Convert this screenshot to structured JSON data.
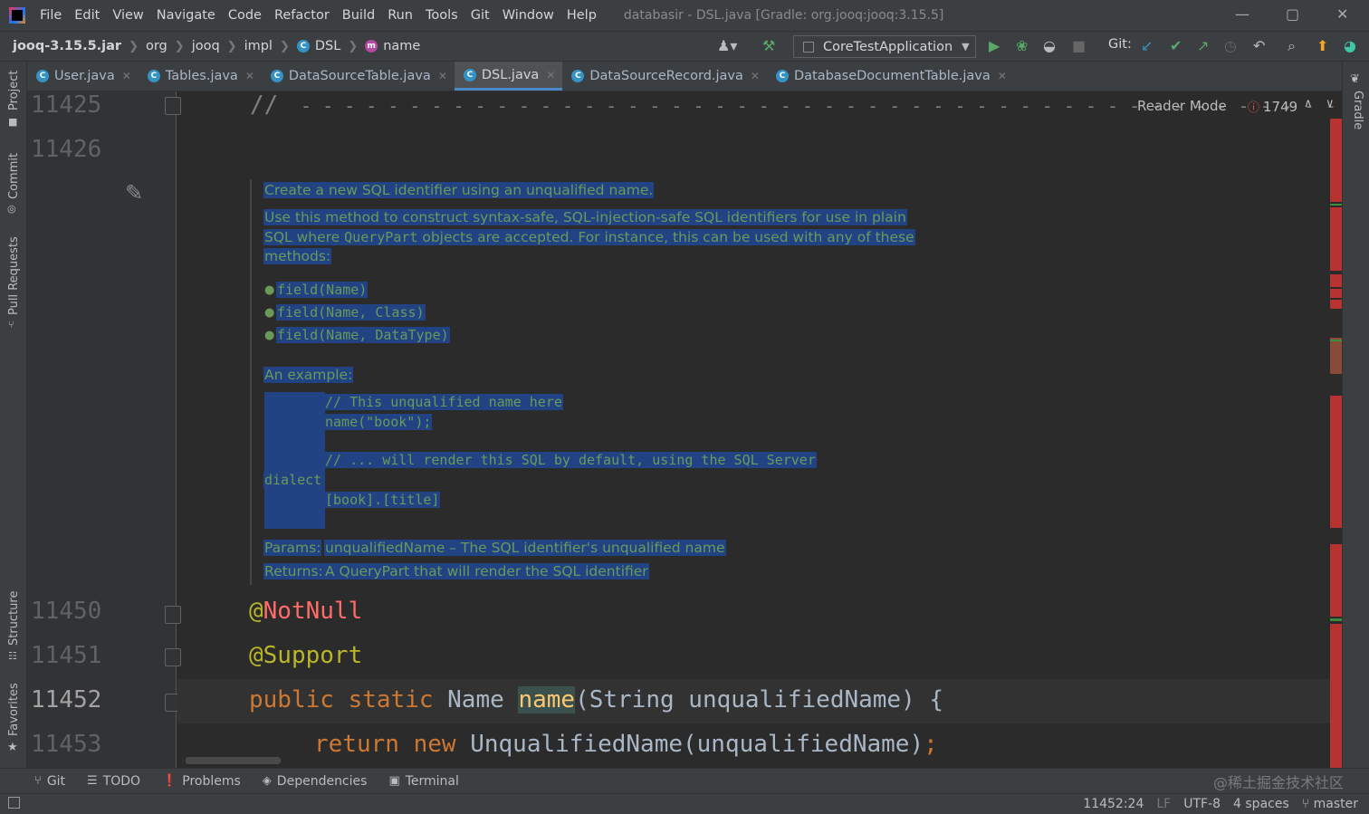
{
  "menu": {
    "items": [
      "File",
      "Edit",
      "View",
      "Navigate",
      "Code",
      "Refactor",
      "Build",
      "Run",
      "Tools",
      "Git",
      "Window",
      "Help"
    ],
    "title": "databasir - DSL.java [Gradle: org.jooq:jooq:3.15.5]"
  },
  "breadcrumb": {
    "jar": "jooq-3.15.5.jar",
    "org": "org",
    "jooq": "jooq",
    "impl": "impl",
    "cls": "DSL",
    "method": "name",
    "class_badge": "C",
    "method_badge": "m"
  },
  "toolbar": {
    "run_config": "CoreTestApplication",
    "git_label": "Git:"
  },
  "tabs": [
    {
      "label": "User.java",
      "badge": "C"
    },
    {
      "label": "Tables.java",
      "badge": "C"
    },
    {
      "label": "DataSourceTable.java",
      "badge": "C"
    },
    {
      "label": "DSL.java",
      "badge": "C"
    },
    {
      "label": "DataSourceRecord.java",
      "badge": "C"
    },
    {
      "label": "DatabaseDocumentTable.java",
      "badge": "C"
    }
  ],
  "left_tools": {
    "project": "Project",
    "commit": "Commit",
    "pull_requests": "Pull Requests",
    "structure": "Structure",
    "favorites": "Favorites"
  },
  "right_tools": {
    "gradle": "Gradle"
  },
  "editor": {
    "reader_mode": "Reader Mode",
    "error_count": "1749",
    "line_numbers": {
      "l1": "11425",
      "l2": "11426",
      "l3": "11450",
      "l4": "11451",
      "l5": "11452",
      "l6": "11453"
    },
    "code": {
      "comment_slash": "//",
      "comment_dashes": "- - - - - - - - - - - - - - - - - - - - - - - - - - - - - - - - - - - - - - - - - - - - - - - - - - -",
      "at1": "@",
      "notnull": "NotNull",
      "support": "@Support",
      "kw_public": "public",
      "kw_static": "static",
      "type_name": "Name",
      "method_name": "name",
      "params": "(String unqualifiedName) {",
      "kw_return": "return",
      "kw_new": "new",
      "ret_expr": "UnqualifiedName(unqualifiedName)",
      "semicolon": ";"
    },
    "doc": {
      "summary": "Create a new SQL identifier using an unqualified name.",
      "para_1": "Use this method to construct syntax-safe, SQL-injection-safe SQL identifiers for use in plain",
      "para_2a": "SQL where ",
      "para_2_code": "QueryPart",
      "para_2b": " objects are accepted. For instance, this can be used with any of these",
      "para_3": "methods:",
      "list": [
        "field(Name)",
        "field(Name, Class)",
        "field(Name, DataType)"
      ],
      "example_label": "An example:",
      "example_lines": {
        "e1": "// This unqualified name here",
        "e2": "name(\"book\");",
        "e3": "// ... will render this SQL by default, using the SQL Server",
        "e4": "dialect",
        "e5": "[book].[title]"
      },
      "params_label": "Params:",
      "params_text": "unqualifiedName – The SQL identifier's unqualified name",
      "returns_label": "Returns:",
      "returns_text": "A QueryPart that will render the SQL identifier"
    }
  },
  "bottom_tools": [
    {
      "label": "Git",
      "icon": "git-branch-icon"
    },
    {
      "label": "TODO",
      "icon": "list-icon"
    },
    {
      "label": "Problems",
      "icon": "info-icon"
    },
    {
      "label": "Dependencies",
      "icon": "layers-icon"
    },
    {
      "label": "Terminal",
      "icon": "terminal-icon"
    }
  ],
  "watermark": "@稀土掘金技术社区",
  "status": {
    "position": "11452:24",
    "line_sep": "LF",
    "encoding": "UTF-8",
    "indent": "4 spaces",
    "branch": "master"
  },
  "colors": {
    "accent": "#4a88c7",
    "selection": "#214283",
    "doc_text": "#6a9a59",
    "error": "#c73e3e"
  }
}
